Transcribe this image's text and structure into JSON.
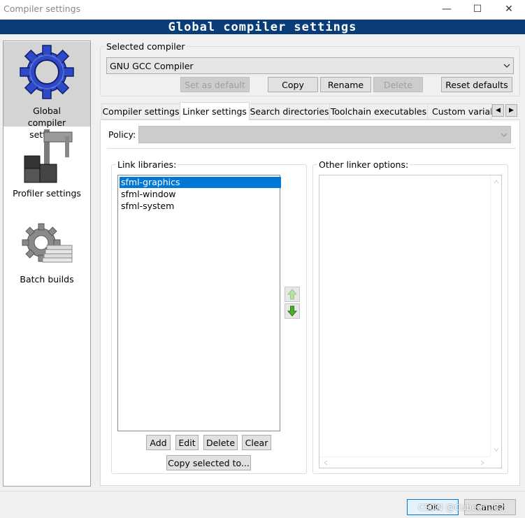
{
  "window": {
    "title": "Compiler settings",
    "controls": {
      "minimize": "—",
      "maximize": "☐",
      "close": "✕"
    }
  },
  "banner": {
    "text": "Global compiler settings"
  },
  "left_panel": {
    "items": [
      {
        "label": "Global compiler settings",
        "icon": "gear-icon",
        "selected": true
      },
      {
        "label": "Profiler settings",
        "icon": "caliper-icon",
        "selected": false
      },
      {
        "label": "Batch builds",
        "icon": "batch-builds-icon",
        "selected": false
      }
    ]
  },
  "selected_compiler": {
    "group_label": "Selected compiler",
    "value": "GNU GCC Compiler",
    "buttons": {
      "set_default": "Set as default",
      "copy": "Copy",
      "rename": "Rename",
      "delete": "Delete",
      "reset": "Reset defaults"
    }
  },
  "tabs": [
    {
      "label": "Compiler settings",
      "active": false
    },
    {
      "label": "Linker settings",
      "active": true
    },
    {
      "label": "Search directories",
      "active": false
    },
    {
      "label": "Toolchain executables",
      "active": false
    },
    {
      "label": "Custom variab",
      "active": false
    }
  ],
  "tab_scroll": {
    "left": "◀",
    "right": "▶"
  },
  "policy": {
    "label": "Policy:",
    "value": ""
  },
  "link_libraries": {
    "label": "Link libraries:",
    "items": [
      "sfml-graphics",
      "sfml-window",
      "sfml-system"
    ],
    "selected_index": 0,
    "buttons": {
      "add": "Add",
      "edit": "Edit",
      "delete": "Delete",
      "clear": "Clear",
      "copy_selected": "Copy selected to..."
    }
  },
  "other_linker_options": {
    "label": "Other linker options:",
    "value": ""
  },
  "dialog_buttons": {
    "ok": "OK",
    "cancel": "Cancel"
  },
  "watermark": "CSDN @Cubeanu82",
  "colors": {
    "banner_bg": "#0a3d78",
    "selection": "#0078d7",
    "arrow_green": "#4caf28",
    "gear_blue": "#2d49c8"
  }
}
